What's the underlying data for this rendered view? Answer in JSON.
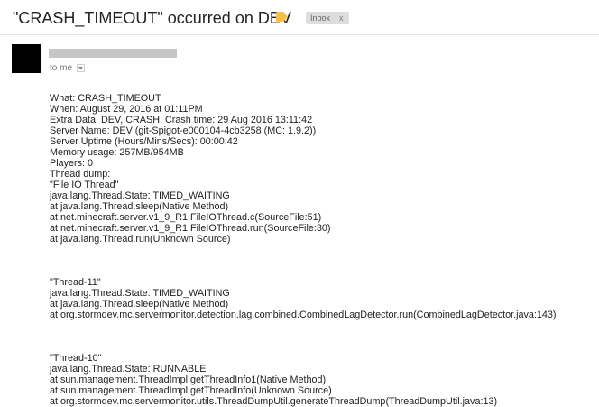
{
  "email": {
    "subject": "\"CRASH_TIMEOUT\" occurred on DEV",
    "label_color": "#f8c04a",
    "inbox_chip": {
      "label": "Inbox",
      "close": "x"
    },
    "recipient": {
      "prefix": "to me",
      "dropdown_icon": "chevron-down-icon"
    }
  },
  "body": {
    "blocks": [
      [
        "What: CRASH_TIMEOUT",
        "When: August 29, 2016 at 01:11PM",
        "Extra Data: DEV, CRASH, Crash time: 29 Aug 2016 13:11:42",
        "Server Name: DEV (git-Spigot-e000104-4cb3258 (MC: 1.9.2))",
        "Server Uptime (Hours/Mins/Secs): 00:00:42",
        "Memory usage: 257MB/954MB",
        "Players: 0",
        "Thread dump:",
        "\"File IO Thread\"",
        "java.lang.Thread.State: TIMED_WAITING",
        "at java.lang.Thread.sleep(Native Method)",
        "at net.minecraft.server.v1_9_R1.FileIOThread.c(SourceFile:51)",
        "at net.minecraft.server.v1_9_R1.FileIOThread.run(SourceFile:30)",
        "at java.lang.Thread.run(Unknown Source)"
      ],
      [
        "\"Thread-11\"",
        "java.lang.Thread.State: TIMED_WAITING",
        "at java.lang.Thread.sleep(Native Method)",
        "at org.stormdev.mc.servermonitor.detection.lag.combined.CombinedLagDetector.run(CombinedLagDetector.java:143)"
      ],
      [
        "\"Thread-10\"",
        "java.lang.Thread.State: RUNNABLE",
        "at sun.management.ThreadImpl.getThreadInfo1(Native Method)",
        "at sun.management.ThreadImpl.getThreadInfo(Unknown Source)",
        "at org.stormdev.mc.servermonitor.utils.ThreadDumpUtil.generateThreadDump(ThreadDumpUtil.java:13)"
      ]
    ]
  }
}
